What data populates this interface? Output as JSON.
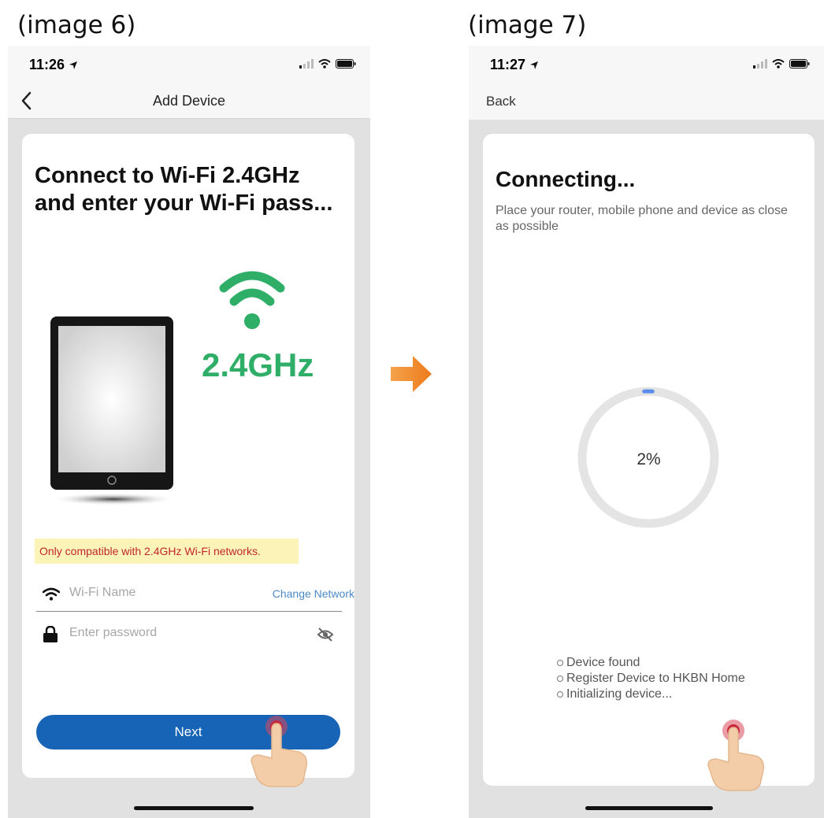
{
  "captions": {
    "left": "(image 6)",
    "right": "(image 7)"
  },
  "screen6": {
    "time": "11:26",
    "nav_title": "Add Device",
    "title_line1": "Connect to Wi-Fi 2.4GHz",
    "title_line2": "and enter your Wi-Fi pass...",
    "badge": "2.4GHz",
    "warning": "Only compatible with 2.4GHz Wi-Fi networks.",
    "wifi_placeholder": "Wi-Fi Name",
    "change_network": "Change Network",
    "password_placeholder": "Enter password",
    "next_label": "Next"
  },
  "screen7": {
    "time": "11:27",
    "back_label": "Back",
    "title": "Connecting...",
    "subtitle": "Place your router, mobile phone and device as close as possible",
    "progress_label": "2%",
    "progress": 0.02,
    "steps": [
      "Device found",
      "Register Device to HKBN Home",
      "Initializing device..."
    ]
  },
  "colors": {
    "primary": "#1763b6",
    "wifi_green": "#2fae68",
    "warning_bg": "#fbf3b7",
    "warning_text": "#c0272d",
    "progress_blue": "#5b8def",
    "arrow_orange": "#f08a24"
  },
  "icons": [
    "location-arrow-icon",
    "signal-icon",
    "wifi-icon",
    "battery-icon",
    "back-chevron-icon",
    "lock-icon",
    "eye-off-icon",
    "tap-hand-icon",
    "right-arrow-icon"
  ]
}
